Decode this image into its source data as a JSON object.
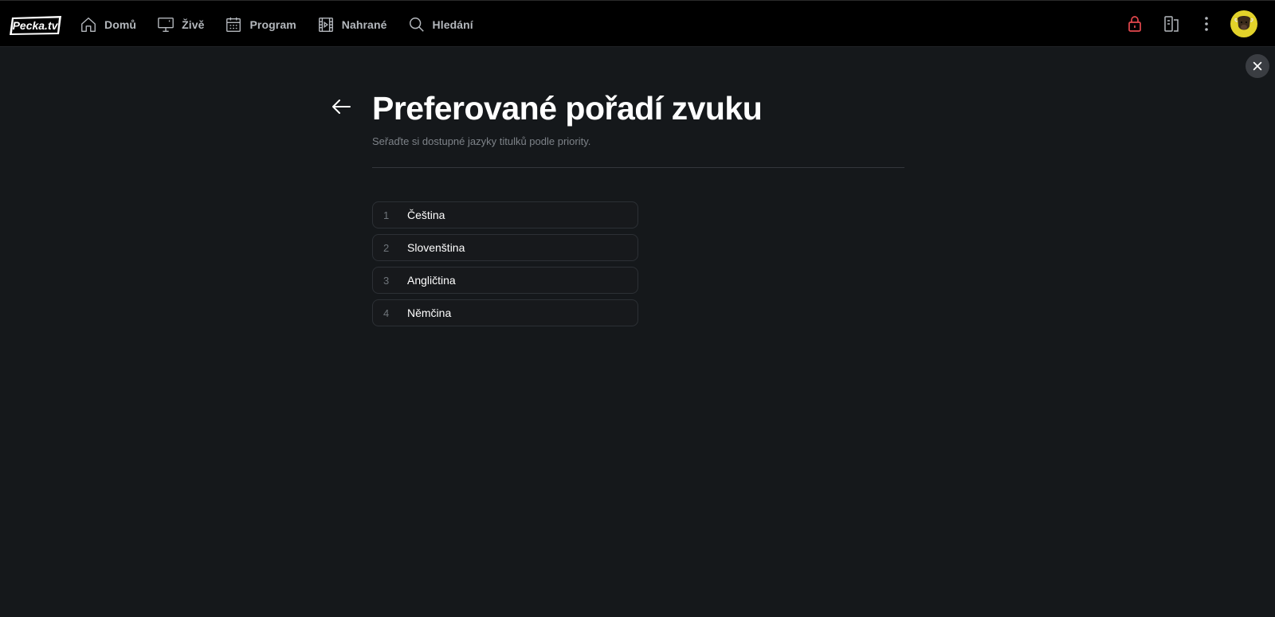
{
  "app": {
    "logo_text": "Pecka.tv"
  },
  "nav": {
    "items": [
      {
        "label": "Domů",
        "icon": "home-icon"
      },
      {
        "label": "Živě",
        "icon": "monitor-icon"
      },
      {
        "label": "Program",
        "icon": "calendar-icon"
      },
      {
        "label": "Nahrané",
        "icon": "film-icon"
      },
      {
        "label": "Hledání",
        "icon": "search-icon"
      }
    ]
  },
  "header_tools": {
    "lock_icon": "lock-icon",
    "devices_icon": "devices-icon",
    "more_icon": "more-vertical-icon",
    "avatar_icon": "bison-avatar"
  },
  "page": {
    "title": "Preferované pořadí zvuku",
    "subtitle": "Seřaďte si dostupné jazyky titulků podle priority."
  },
  "languages": [
    {
      "num": "1",
      "name": "Čeština"
    },
    {
      "num": "2",
      "name": "Slovenština"
    },
    {
      "num": "3",
      "name": "Angličtina"
    },
    {
      "num": "4",
      "name": "Němčina"
    }
  ],
  "colors": {
    "background": "#15181b",
    "topbar": "#000000",
    "lock_accent": "#e5484d",
    "avatar_bg": "#e2d22a",
    "nav_text": "#b4b8bd"
  }
}
